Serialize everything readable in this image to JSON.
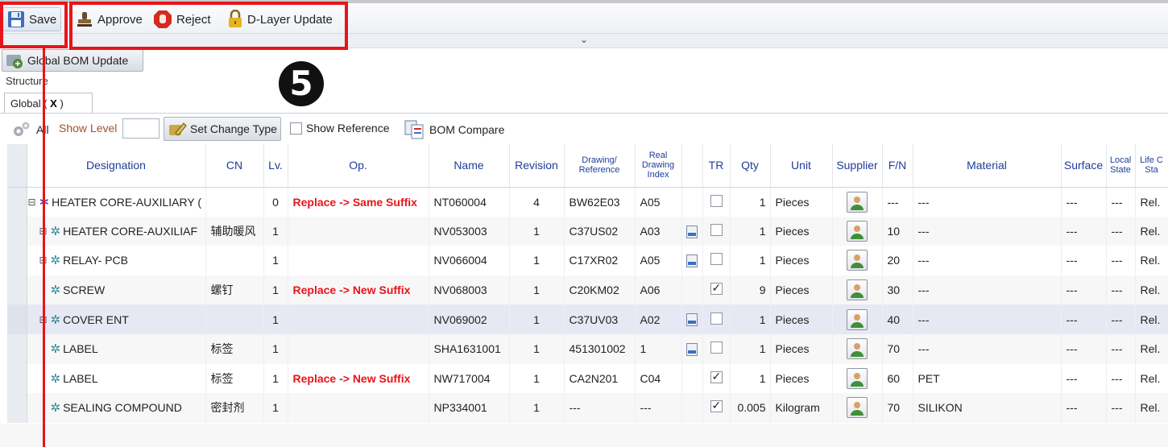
{
  "toolbar": {
    "save_label": "Save",
    "approve_label": "Approve",
    "reject_label": "Reject",
    "dlayer_label": "D-Layer Update"
  },
  "annotation": {
    "step_number": "5"
  },
  "global_bom_button": "Global BOM Update",
  "structure_label": "Structure",
  "tab": {
    "label_prefix": "Global (",
    "label_mask": " X ",
    "label_suffix": ")"
  },
  "filter": {
    "all_label": "All",
    "show_level_label": "Show Level",
    "show_level_value": "",
    "set_change_type_label": "Set Change Type",
    "show_reference_label": "Show Reference",
    "show_reference_checked": false,
    "bom_compare_label": "BOM Compare"
  },
  "columns": [
    {
      "key": "designation",
      "label": "Designation"
    },
    {
      "key": "cn",
      "label": "CN"
    },
    {
      "key": "lv",
      "label": "Lv."
    },
    {
      "key": "op",
      "label": "Op."
    },
    {
      "key": "name",
      "label": "Name"
    },
    {
      "key": "revision",
      "label": "Revision"
    },
    {
      "key": "drawing",
      "label": "Drawing/ Reference"
    },
    {
      "key": "rdi",
      "label": "Real Drawing Index"
    },
    {
      "key": "doc",
      "label": ""
    },
    {
      "key": "tr",
      "label": "TR"
    },
    {
      "key": "qty",
      "label": "Qty"
    },
    {
      "key": "unit",
      "label": "Unit"
    },
    {
      "key": "supplier",
      "label": "Supplier"
    },
    {
      "key": "fn",
      "label": "F/N"
    },
    {
      "key": "material",
      "label": "Material"
    },
    {
      "key": "surface",
      "label": "Surface"
    },
    {
      "key": "local_state",
      "label": "Local State"
    },
    {
      "key": "life",
      "label": "Life C Sta"
    }
  ],
  "rows": [
    {
      "designation": "HEATER CORE-AUXILIARY (",
      "cn": "",
      "lv": "0",
      "op": "Replace -> Same Suffix",
      "name": "NT060004",
      "revision": "4",
      "drawing": "BW62E03",
      "rdi": "A05",
      "doc": false,
      "tr": false,
      "qty": "1",
      "unit": "Pieces",
      "fn": "---",
      "material": "---",
      "surface": "---",
      "local_state": "---",
      "life": "Rel.",
      "root": true,
      "tree": "⊟"
    },
    {
      "designation": "HEATER CORE-AUXILIAF",
      "cn": "辅助暖风",
      "lv": "1",
      "op": "",
      "name": "NV053003",
      "revision": "1",
      "drawing": "C37US02",
      "rdi": "A03",
      "doc": true,
      "tr": false,
      "qty": "1",
      "unit": "Pieces",
      "fn": "10",
      "material": "---",
      "surface": "---",
      "local_state": "---",
      "life": "Rel.",
      "tree": "⊞"
    },
    {
      "designation": "RELAY- PCB",
      "cn": "",
      "lv": "1",
      "op": "",
      "name": "NV066004",
      "revision": "1",
      "drawing": "C17XR02",
      "rdi": "A05",
      "doc": true,
      "tr": false,
      "qty": "1",
      "unit": "Pieces",
      "fn": "20",
      "material": "---",
      "surface": "---",
      "local_state": "---",
      "life": "Rel.",
      "tree": "⊞"
    },
    {
      "designation": "SCREW",
      "cn": "螺钉",
      "lv": "1",
      "op": "Replace -> New Suffix",
      "name": "NV068003",
      "revision": "1",
      "drawing": "C20KM02",
      "rdi": "A06",
      "doc": false,
      "tr": true,
      "qty": "9",
      "unit": "Pieces",
      "fn": "30",
      "material": "---",
      "surface": "---",
      "local_state": "---",
      "life": "Rel.",
      "tree": ""
    },
    {
      "designation": "COVER ENT",
      "cn": "",
      "lv": "1",
      "op": "",
      "name": "NV069002",
      "revision": "1",
      "drawing": "C37UV03",
      "rdi": "A02",
      "doc": true,
      "tr": false,
      "qty": "1",
      "unit": "Pieces",
      "fn": "40",
      "material": "---",
      "surface": "---",
      "local_state": "---",
      "life": "Rel.",
      "tree": "⊞",
      "selected": true
    },
    {
      "designation": "LABEL",
      "cn": "标签",
      "lv": "1",
      "op": "",
      "name": "SHA1631001",
      "revision": "1",
      "drawing": "451301002",
      "rdi": "1",
      "doc": true,
      "tr": false,
      "qty": "1",
      "unit": "Pieces",
      "fn": "70",
      "material": "---",
      "surface": "---",
      "local_state": "---",
      "life": "Rel.",
      "tree": ""
    },
    {
      "designation": "LABEL",
      "cn": "标签",
      "lv": "1",
      "op": "Replace -> New Suffix",
      "name": "NW717004",
      "revision": "1",
      "drawing": "CA2N201",
      "rdi": "C04",
      "doc": false,
      "tr": true,
      "qty": "1",
      "unit": "Pieces",
      "fn": "60",
      "material": "PET",
      "surface": "---",
      "local_state": "---",
      "life": "Rel.",
      "tree": ""
    },
    {
      "designation": "SEALING COMPOUND",
      "cn": "密封剂",
      "lv": "1",
      "op": "",
      "name": "NP334001",
      "revision": "1",
      "drawing": "---",
      "rdi": "---",
      "doc": false,
      "tr": true,
      "qty": "0.005",
      "unit": "Kilogram",
      "fn": "70",
      "material": "SILIKON",
      "surface": "---",
      "local_state": "---",
      "life": "Rel.",
      "tree": ""
    }
  ],
  "colors": {
    "annotation_red": "#e8141b",
    "header_text": "#1f3d99",
    "op_red": "#e8141b"
  }
}
